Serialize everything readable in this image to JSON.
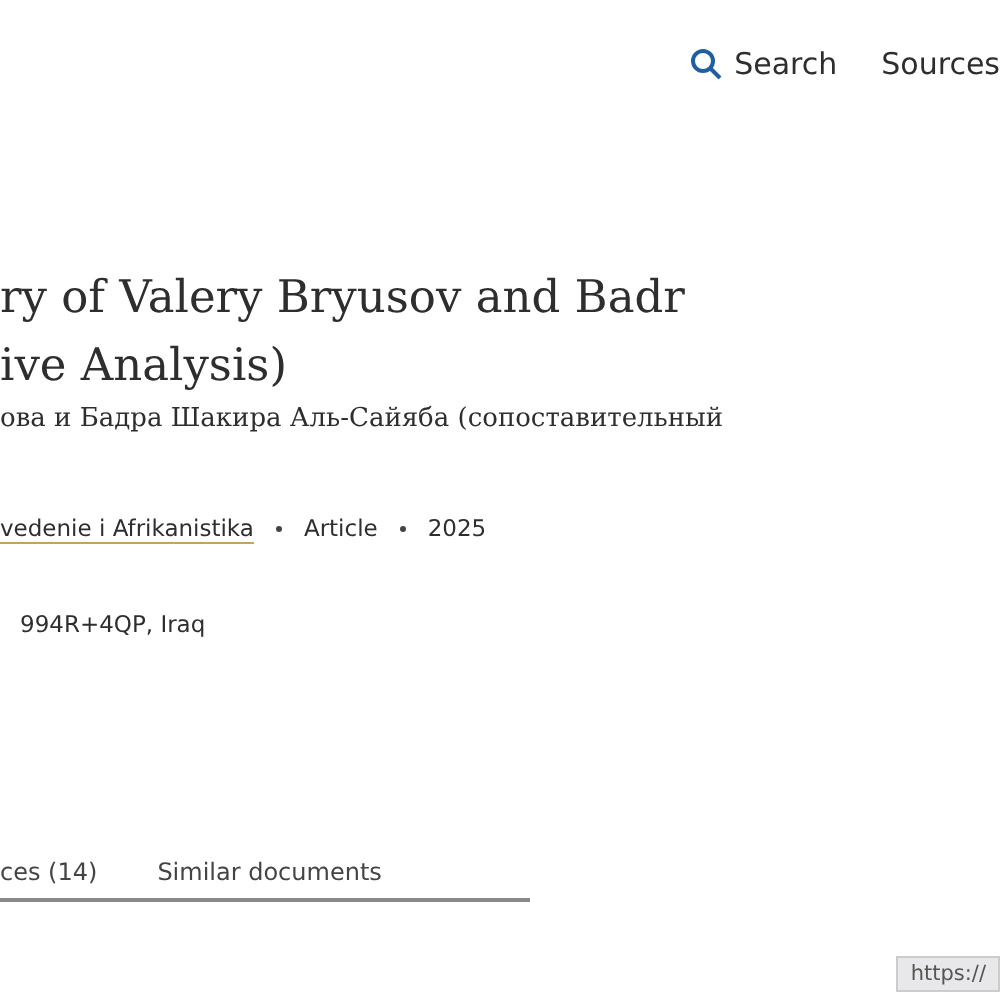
{
  "header": {
    "search": "Search",
    "sources": "Sources"
  },
  "title": "ry of Valery Bryusov and Badr\nive Analysis)",
  "subtitle": "ова и Бадра Шакира Аль-Сайяба (сопоставительный",
  "meta": {
    "journal": "vedenie i Afrikanistika",
    "type": "Article",
    "year": "2025"
  },
  "address": "994R+4QP, Iraq",
  "tabs": [
    {
      "label": "ces (14)",
      "selected": false
    },
    {
      "label": "Similar documents",
      "selected": false
    }
  ],
  "status_url": "https://"
}
